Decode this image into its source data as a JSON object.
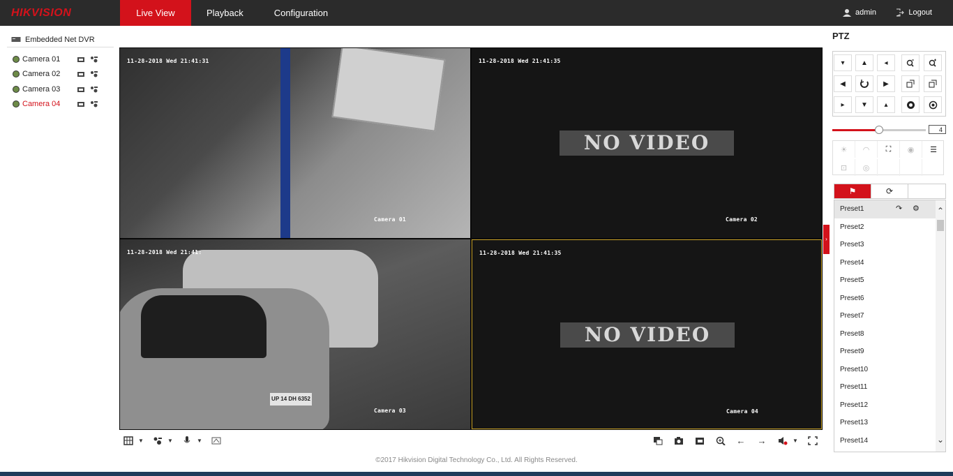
{
  "header": {
    "logo": "HIKVISION",
    "nav": [
      "Live View",
      "Playback",
      "Configuration"
    ],
    "user": "admin",
    "logout": "Logout"
  },
  "tree": {
    "root": "Embedded Net DVR",
    "cameras": [
      "Camera 01",
      "Camera 02",
      "Camera 03",
      "Camera 04"
    ]
  },
  "video": {
    "cells": [
      {
        "timestamp": "11-28-2018 Wed 21:41:31",
        "label": "Camera 01",
        "status": ""
      },
      {
        "timestamp": "11-28-2018 Wed 21:41:35",
        "label": "Camera 02",
        "status": "NO VIDEO"
      },
      {
        "timestamp": "11-28-2018 Wed 21:41:",
        "label": "Camera 03",
        "status": "",
        "plate": "UP 14 DH 6352"
      },
      {
        "timestamp": "11-28-2018 Wed 21:41:35",
        "label": "Camera 04",
        "status": "NO VIDEO"
      }
    ]
  },
  "ptz": {
    "title": "PTZ",
    "speed": "4",
    "speed_level": 0.5
  },
  "presets": [
    "Preset1",
    "Preset2",
    "Preset3",
    "Preset4",
    "Preset5",
    "Preset6",
    "Preset7",
    "Preset8",
    "Preset9",
    "Preset10",
    "Preset11",
    "Preset12",
    "Preset13",
    "Preset14"
  ],
  "footer": "©2017 Hikvision Digital Technology Co., Ltd. All Rights Reserved.",
  "colors": {
    "accent": "#d3121b",
    "header_bg": "#2b2b2b"
  }
}
